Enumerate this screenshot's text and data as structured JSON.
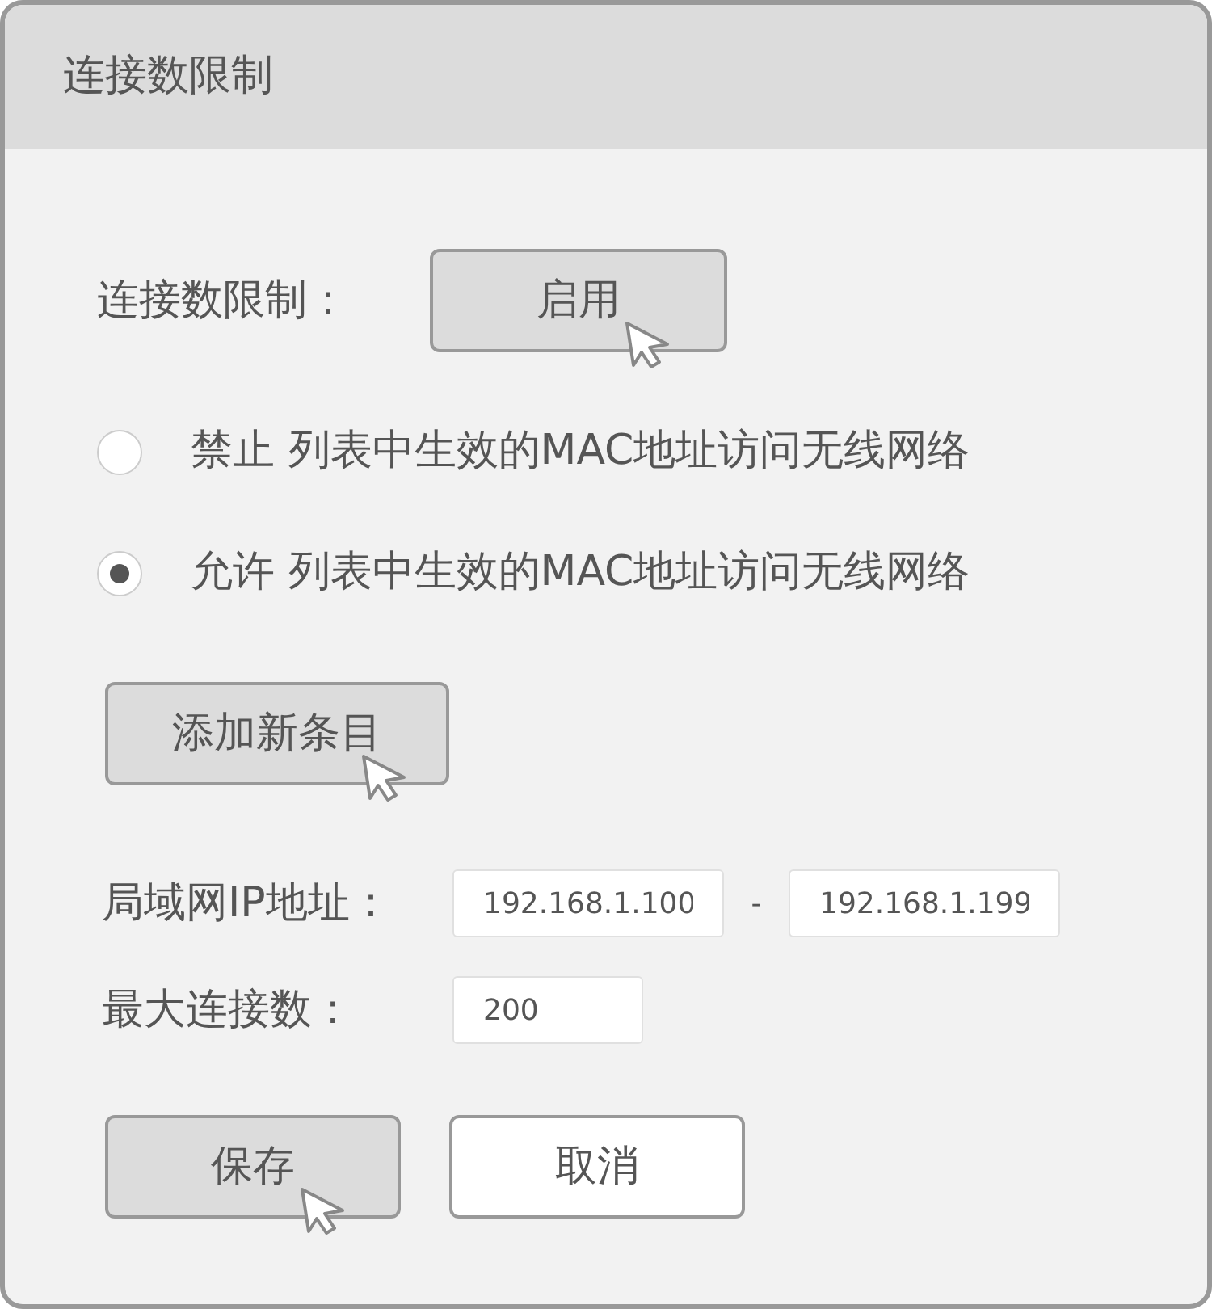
{
  "dialog": {
    "title": "连接数限制"
  },
  "limit": {
    "label": "连接数限制：",
    "button": {
      "label": "启用",
      "pressed": true,
      "cursor": true
    }
  },
  "radios": [
    {
      "label": "禁止 列表中生效的MAC地址访问无线网络",
      "selected": false
    },
    {
      "label": "允许 列表中生效的MAC地址访问无线网络",
      "selected": true
    }
  ],
  "add_button": {
    "label": "添加新条目",
    "pressed": true,
    "cursor": true
  },
  "ip_range": {
    "label": "局域网IP地址：",
    "start": "192.168.1.100",
    "separator": "-",
    "end": "192.168.1.199"
  },
  "max_connections": {
    "label": "最大连接数：",
    "value": "200"
  },
  "buttons": [
    {
      "label": "保存",
      "pressed": true,
      "cursor": true
    },
    {
      "label": "取消",
      "pressed": false,
      "cursor": false
    }
  ]
}
